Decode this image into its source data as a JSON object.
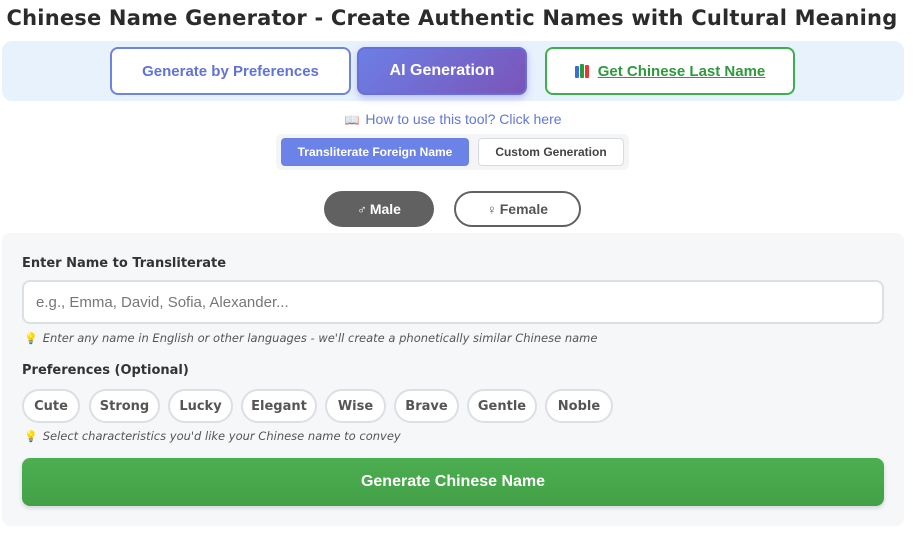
{
  "page": {
    "title": "Chinese Name Generator - Create Authentic Names with Cultural Meaning"
  },
  "modes": {
    "preferences_label": "Generate by Preferences",
    "ai_label": "AI Generation",
    "last_name_label": "Get Chinese Last Name",
    "active": "AI Generation"
  },
  "help": {
    "icon": "open-book-icon",
    "text": "How to use this tool? Click here"
  },
  "sub_tabs": {
    "transliterate_label": "Transliterate Foreign Name",
    "custom_label": "Custom Generation",
    "active": "Transliterate Foreign Name"
  },
  "gender": {
    "male_symbol": "♂",
    "male_label": "Male",
    "female_symbol": "♀",
    "female_label": "Female",
    "selected": "Male"
  },
  "form": {
    "name_label": "Enter Name to Transliterate",
    "name_placeholder": "e.g., Emma, David, Sofia, Alexander...",
    "name_value": "",
    "name_hint": "Enter any name in English or other languages - we'll create a phonetically similar Chinese name",
    "preferences_label": "Preferences (Optional)",
    "preferences": [
      "Cute",
      "Strong",
      "Lucky",
      "Elegant",
      "Wise",
      "Brave",
      "Gentle",
      "Noble"
    ],
    "preferences_hint": "Select characteristics you'd like your Chinese name to convey",
    "submit_label": "Generate Chinese Name"
  },
  "colors": {
    "accent_blue": "#6b83e6",
    "accent_purple": "#7a55b8",
    "accent_green": "#4caf50",
    "gender_dark": "#616161"
  }
}
